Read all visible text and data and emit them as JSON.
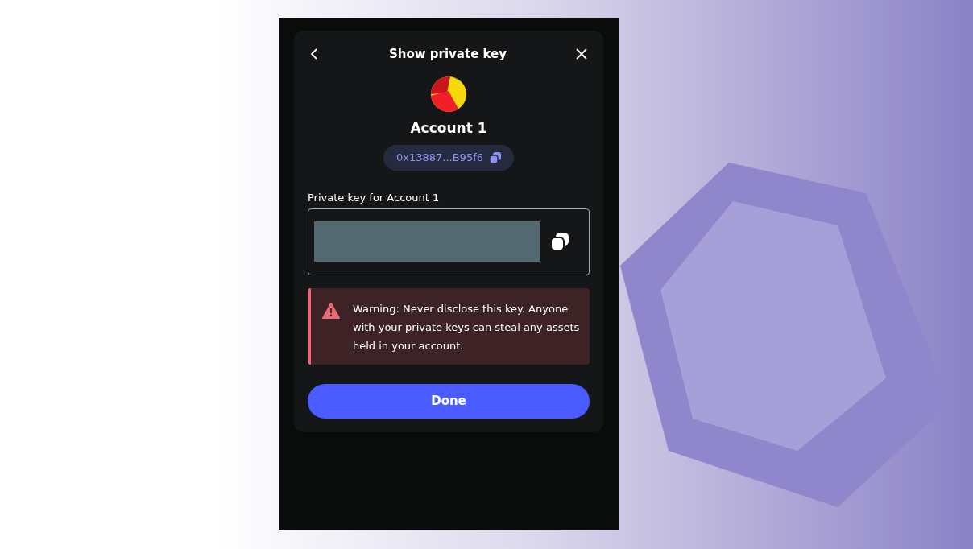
{
  "dialog": {
    "title": "Show private key",
    "account": {
      "name": "Account 1",
      "address": "0x13887...B95f6"
    },
    "private_key": {
      "label": "Private key for Account 1"
    },
    "warning": {
      "text": "Warning: Never disclose this key. Anyone with your private keys can steal any assets held in your account."
    },
    "buttons": [
      {
        "label": "Done",
        "kind": "primary"
      }
    ]
  }
}
